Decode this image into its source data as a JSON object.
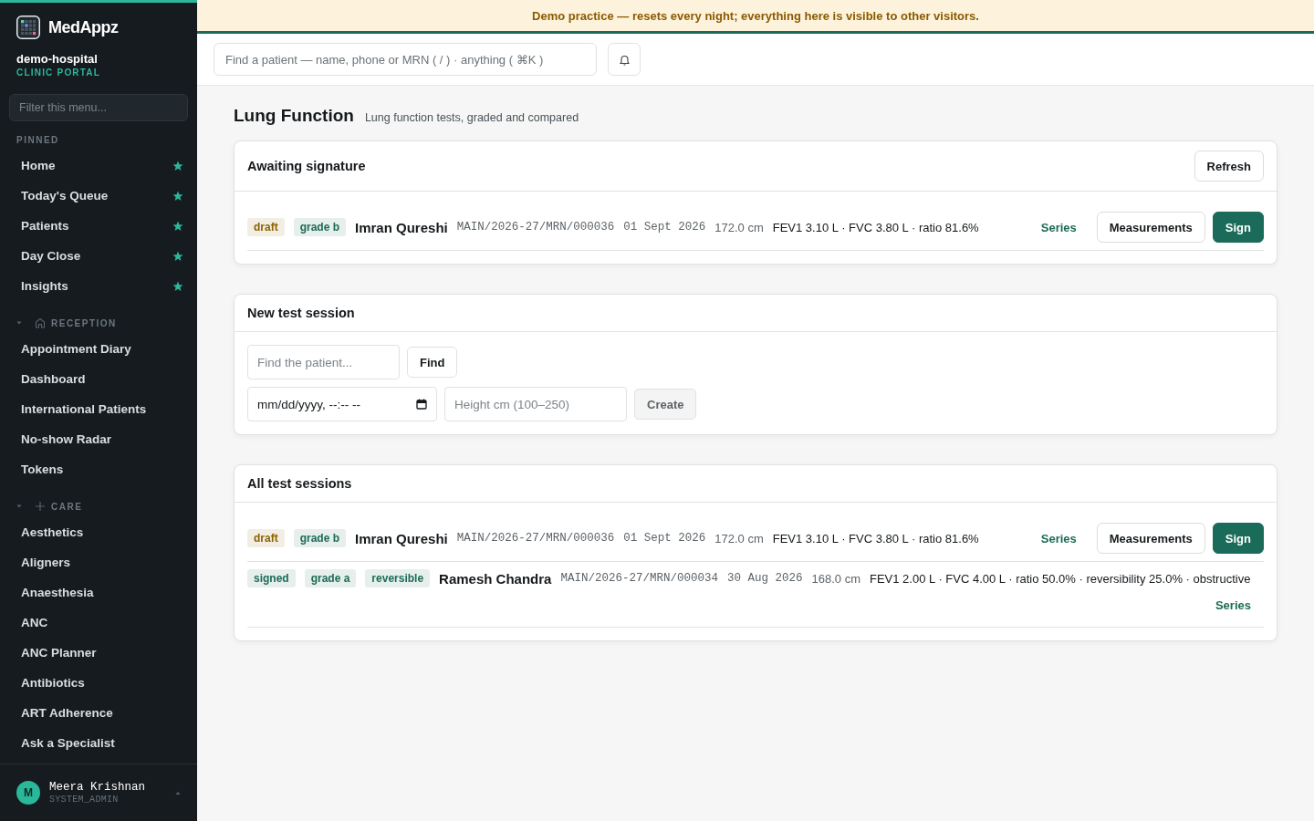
{
  "banner": {
    "text": "Demo practice — resets every night; everything here is visible to other visitors."
  },
  "brand": {
    "name": "MedAppz",
    "org": "demo-hospital",
    "portal": "CLINIC PORTAL"
  },
  "sidebar": {
    "filter_placeholder": "Filter this menu...",
    "sections": [
      {
        "title": "PINNED",
        "kind": "pinned",
        "items": [
          {
            "label": "Home",
            "pinned": true
          },
          {
            "label": "Today's Queue",
            "pinned": true
          },
          {
            "label": "Patients",
            "pinned": true
          },
          {
            "label": "Day Close",
            "pinned": true
          },
          {
            "label": "Insights",
            "pinned": true
          }
        ]
      },
      {
        "title": "RECEPTION",
        "kind": "group",
        "expanded": true,
        "items": [
          {
            "label": "Appointment Diary",
            "pinned": false
          },
          {
            "label": "Dashboard",
            "pinned": false
          },
          {
            "label": "International Patients",
            "pinned": false
          },
          {
            "label": "No-show Radar",
            "pinned": false
          },
          {
            "label": "Tokens",
            "pinned": false
          }
        ]
      },
      {
        "title": "CARE",
        "kind": "group",
        "expanded": true,
        "items": [
          {
            "label": "Aesthetics",
            "pinned": false
          },
          {
            "label": "Aligners",
            "pinned": false
          },
          {
            "label": "Anaesthesia",
            "pinned": false
          },
          {
            "label": "ANC",
            "pinned": false
          },
          {
            "label": "ANC Planner",
            "pinned": false
          },
          {
            "label": "Antibiotics",
            "pinned": false
          },
          {
            "label": "ART Adherence",
            "pinned": false
          },
          {
            "label": "Ask a Specialist",
            "pinned": false
          }
        ]
      }
    ],
    "user": {
      "initial": "M",
      "name": "Meera Krishnan",
      "role": "SYSTEM_ADMIN"
    }
  },
  "topbar": {
    "search_placeholder": "Find a patient — name, phone or MRN ( / ) · anything ( ⌘K )"
  },
  "page": {
    "title": "Lung Function",
    "subtitle": "Lung function tests, graded and compared"
  },
  "awaiting": {
    "title": "Awaiting signature",
    "refresh": "Refresh",
    "sessions": [
      {
        "tags": [
          {
            "label": "draft",
            "color": "#8a6200"
          },
          {
            "label": "grade b",
            "color": "#1b6b55"
          }
        ],
        "name": "Imran Qureshi",
        "mrn": "MAIN/2026-27/MRN/000036",
        "date": "01 Sept 2026",
        "height": "172.0 cm",
        "summary": "FEV1 3.10 L · FVC 3.80 L · ratio 81.6%",
        "series": "Series",
        "actions": [
          {
            "label": "Measurements",
            "kind": "secondary"
          },
          {
            "label": "Sign",
            "kind": "primary"
          }
        ]
      }
    ]
  },
  "new_session": {
    "title": "New test session",
    "patient_placeholder": "Find the patient...",
    "find": "Find",
    "datetime_value": "mm/dd/yyyy, --:-- --",
    "height_placeholder": "Height cm (100–250)",
    "create": "Create"
  },
  "all_sessions": {
    "title": "All test sessions",
    "sessions": [
      {
        "tags": [
          {
            "label": "draft",
            "color": "#8a6200"
          },
          {
            "label": "grade b",
            "color": "#1b6b55"
          }
        ],
        "name": "Imran Qureshi",
        "mrn": "MAIN/2026-27/MRN/000036",
        "date": "01 Sept 2026",
        "height": "172.0 cm",
        "summary": "FEV1 3.10 L · FVC 3.80 L · ratio 81.6%",
        "series": "Series",
        "actions": [
          {
            "label": "Measurements",
            "kind": "secondary"
          },
          {
            "label": "Sign",
            "kind": "primary"
          }
        ]
      },
      {
        "tags": [
          {
            "label": "signed",
            "color": "#1b6b55"
          },
          {
            "label": "grade a",
            "color": "#1b6b55"
          },
          {
            "label": "reversible",
            "color": "#1b6b55"
          }
        ],
        "name": "Ramesh Chandra",
        "mrn": "MAIN/2026-27/MRN/000034",
        "date": "30 Aug 2026",
        "height": "168.0 cm",
        "summary": "FEV1 2.00 L · FVC 4.00 L · ratio 50.0% · reversibility 25.0% · obstructive",
        "series": "Series"
      }
    ]
  }
}
